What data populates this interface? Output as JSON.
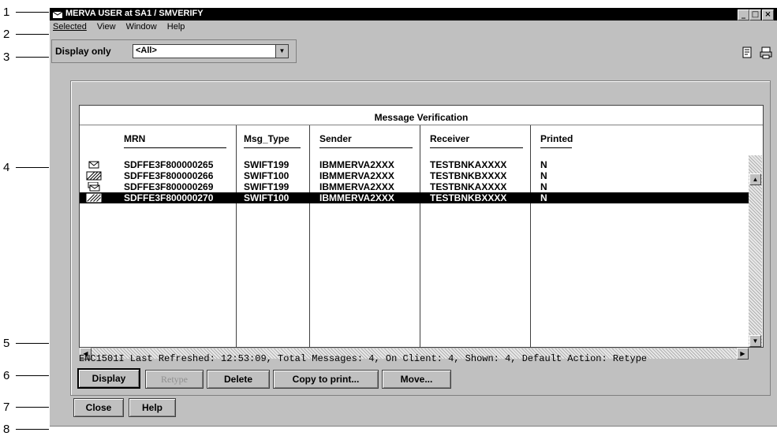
{
  "callouts": [
    "1",
    "2",
    "3",
    "4",
    "5",
    "6",
    "7",
    "8"
  ],
  "window": {
    "title": "MERVA USER at SA1 / SMVERIFY"
  },
  "menu": {
    "selected": "Selected",
    "view": "View",
    "window": "Window",
    "help": "Help"
  },
  "filter": {
    "label": "Display only",
    "value": "<All>"
  },
  "list": {
    "title": "Message Verification",
    "columns": [
      "MRN",
      "Msg_Type",
      "Sender",
      "Receiver",
      "Printed"
    ],
    "rows": [
      {
        "icon": "envelope-icon",
        "mrn": "SDFFE3F800000265",
        "type": "SWIFT199",
        "sender": "IBMMERVA2XXX",
        "receiver": "TESTBNKAXXXX",
        "printed": "N",
        "selected": false
      },
      {
        "icon": "hatched-envelope-icon",
        "mrn": "SDFFE3F800000266",
        "type": "SWIFT100",
        "sender": "IBMMERVA2XXX",
        "receiver": "TESTBNKBXXXX",
        "printed": "N",
        "selected": false
      },
      {
        "icon": "stacked-messages-icon",
        "mrn": "SDFFE3F800000269",
        "type": "SWIFT199",
        "sender": "IBMMERVA2XXX",
        "receiver": "TESTBNKAXXXX",
        "printed": "N",
        "selected": false
      },
      {
        "icon": "hatched-envelope-icon",
        "mrn": "SDFFE3F800000270",
        "type": "SWIFT100",
        "sender": "IBMMERVA2XXX",
        "receiver": "TESTBNKBXXXX",
        "printed": "N",
        "selected": true
      }
    ]
  },
  "status": "ENC1501I Last Refreshed: 12:53:09, Total Messages: 4, On Client: 4, Shown: 4, Default Action:  Retype",
  "actions": {
    "display": "Display",
    "retype": "Retype",
    "delete": "Delete",
    "copy": "Copy to print...",
    "move": "Move..."
  },
  "footer": {
    "close": "Close",
    "help": "Help"
  },
  "colors": {
    "titlebar": "#000000",
    "face": "#c0c0c0",
    "selection": "#000000"
  }
}
